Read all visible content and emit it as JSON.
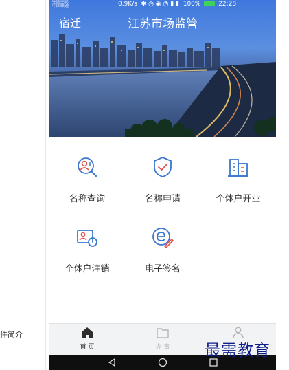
{
  "side_caption": "件简介",
  "status_bar": {
    "carrier_line1": "中国电信",
    "carrier_line2": "中国联通",
    "speed": "0.9K/s",
    "battery": "100%",
    "time": "22:28"
  },
  "header": {
    "city": "宿迁",
    "title": "江苏市场监管"
  },
  "services": [
    {
      "label": "名称查询",
      "icon": "name-search-icon"
    },
    {
      "label": "名称申请",
      "icon": "shield-check-icon"
    },
    {
      "label": "个体户开业",
      "icon": "building-icon"
    },
    {
      "label": "个体户注销",
      "icon": "deregister-icon"
    },
    {
      "label": "电子签名",
      "icon": "e-signature-icon"
    }
  ],
  "tabbar": [
    {
      "label": "首 页",
      "icon": "home-icon"
    },
    {
      "label": "办 事",
      "icon": "folder-icon"
    },
    {
      "label": "",
      "icon": "user-icon"
    }
  ],
  "watermark": "最需教育",
  "colors": {
    "accent": "#2f6fd6",
    "icon_blue": "#3b77d0",
    "icon_red": "#e0524b"
  }
}
